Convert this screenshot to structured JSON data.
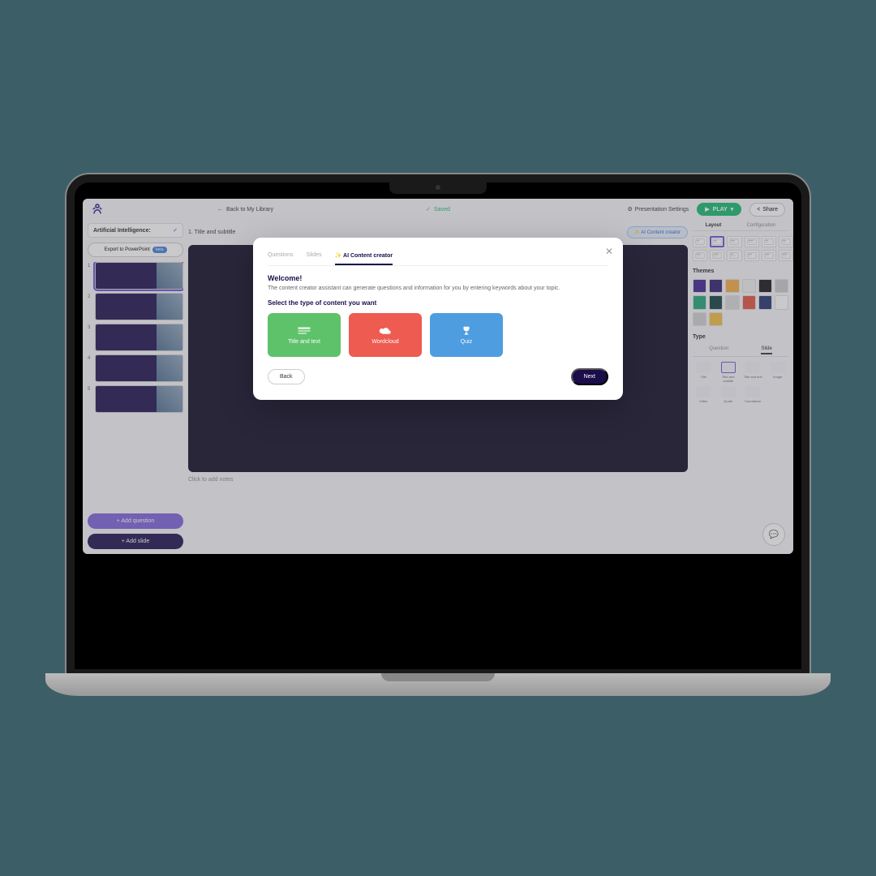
{
  "topbar": {
    "back_label": "Back to My Library",
    "saved_label": "Saved",
    "settings_label": "Presentation Settings",
    "play_label": "PLAY",
    "share_label": "Share"
  },
  "sidebar": {
    "title": "Artificial Intelligence:",
    "export_label": "Export to PowerPoint",
    "export_badge": "beta",
    "slides": [
      {
        "n": "1"
      },
      {
        "n": "2"
      },
      {
        "n": "3"
      },
      {
        "n": "4"
      },
      {
        "n": "5"
      }
    ],
    "add_question_label": "+  Add question",
    "add_slide_label": "+  Add slide"
  },
  "main": {
    "slide_label": "1. Title and subtitle",
    "ai_btn": "✨ AI Content creator",
    "notes_hint": "Click to add notes"
  },
  "right": {
    "tabs": [
      "Layout",
      "Configuration"
    ],
    "themes_label": "Themes",
    "themes": [
      "#3b1c8c",
      "#2c1a6b",
      "#f4a940",
      "#f0f0f0",
      "#111",
      "#c9c9c9",
      "#19a36f",
      "#0d3b3b",
      "#d9d9d9",
      "#e04f3a",
      "#1e2f6b",
      "#ffffff",
      "#cfcfcf",
      "#f1bb3c"
    ],
    "type_label": "Type",
    "type_tabs": [
      "Question",
      "Slide"
    ],
    "types": [
      "Title",
      "Title and subtitle",
      "Title and text",
      "Image",
      "Video",
      "Quote",
      "Countdown"
    ]
  },
  "modal": {
    "tabs": [
      "Questions",
      "Slides",
      "✨ AI Content creator"
    ],
    "heading": "Welcome!",
    "desc": "The content creator assistant can generate questions and information for you by entering keywords about your topic.",
    "select_label": "Select the type of content you want",
    "opts": [
      {
        "label": "Title and text"
      },
      {
        "label": "Wordcloud"
      },
      {
        "label": "Quiz"
      }
    ],
    "back": "Back",
    "next": "Next"
  }
}
